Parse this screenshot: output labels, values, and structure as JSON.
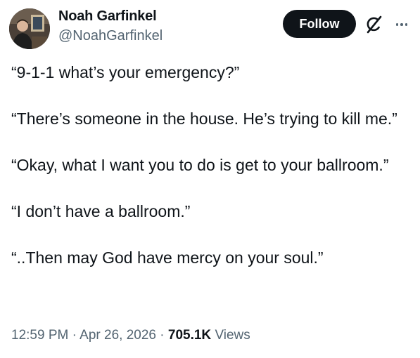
{
  "author": {
    "name": "Noah Garfinkel",
    "handle": "@NoahGarfinkel"
  },
  "actions": {
    "follow_label": "Follow"
  },
  "icons": {
    "grok": "grok-icon",
    "more": "more-options-icon"
  },
  "tweet": {
    "paragraphs": [
      "“9-1-1 what’s your emergency?”",
      "“There’s someone in the house. He’s trying to kill me.”",
      "“Okay, what I want you to do is get to your ballroom.”",
      "“I don’t have a ballroom.”",
      "“..Then may God have mercy on your soul.”"
    ]
  },
  "meta": {
    "time": "12:59 PM",
    "date": "Apr 26, 2026",
    "views_count": "705.1K",
    "views_label": "Views",
    "separator": "·"
  },
  "colors": {
    "text": "#0f1419",
    "secondary": "#536471",
    "follow_bg": "#0f1419"
  }
}
